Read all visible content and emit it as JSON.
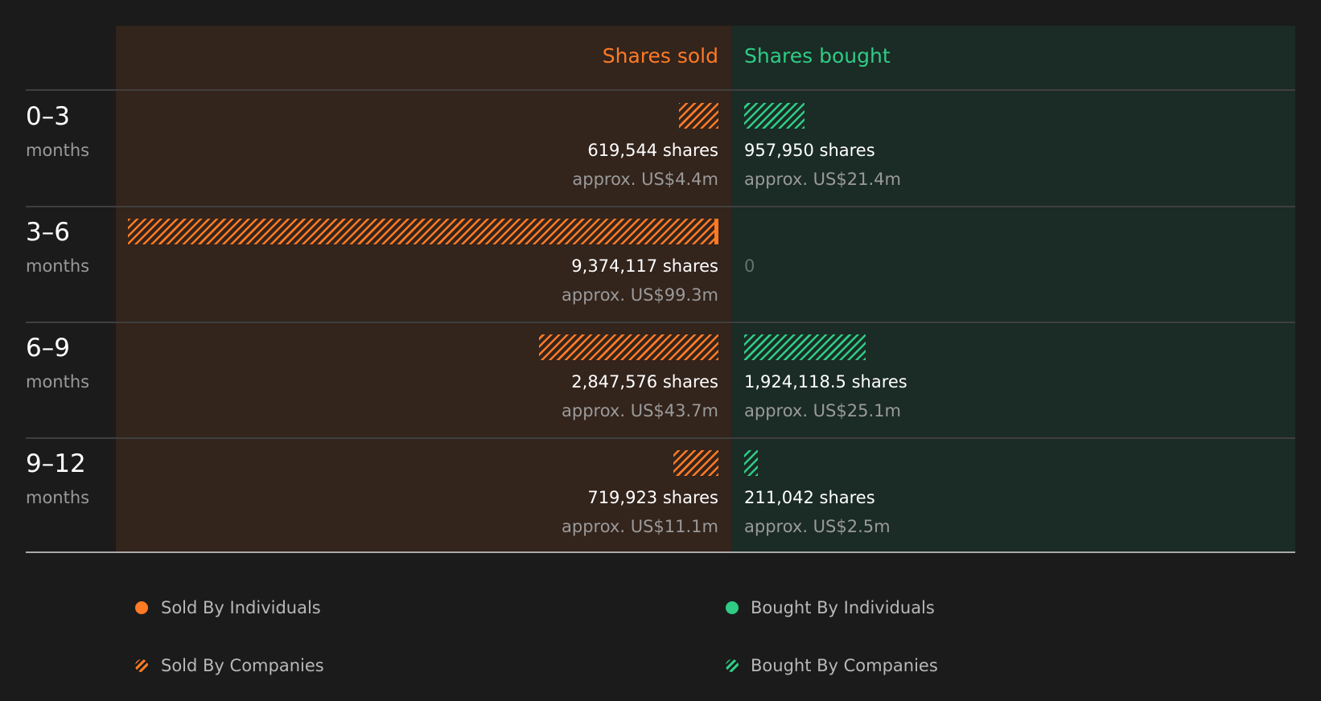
{
  "chart_data": {
    "type": "bar",
    "columns": {
      "sold_label": "Shares sold",
      "bought_label": "Shares bought"
    },
    "rows": [
      {
        "period": "0–3",
        "unit": "months",
        "sold_value": 619544,
        "sold_shares": "619,544 shares",
        "sold_approx": "approx. US$4.4m",
        "bought_value": 957950,
        "bought_shares": "957,950 shares",
        "bought_approx": "approx. US$21.4m"
      },
      {
        "period": "3–6",
        "unit": "months",
        "sold_value": 9374117,
        "sold_shares": "9,374,117 shares",
        "sold_approx": "approx. US$99.3m",
        "sold_individuals_value": 140000,
        "bought_value": 0,
        "bought_shares": "0",
        "bought_approx": ""
      },
      {
        "period": "6–9",
        "unit": "months",
        "sold_value": 2847576,
        "sold_shares": "2,847,576 shares",
        "sold_approx": "approx. US$43.7m",
        "bought_value": 1924118.5,
        "bought_shares": "1,924,118.5 shares",
        "bought_approx": "approx. US$25.1m"
      },
      {
        "period": "9–12",
        "unit": "months",
        "sold_value": 719923,
        "sold_shares": "719,923 shares",
        "sold_approx": "approx. US$11.1m",
        "bought_value": 211042,
        "bought_shares": "211,042 shares",
        "bought_approx": "approx. US$2.5m"
      }
    ],
    "max_value": 9374117,
    "legend": [
      {
        "label": "Sold By Individuals",
        "style": "solid",
        "color": "#ff7a25"
      },
      {
        "label": "Bought By Individuals",
        "style": "solid",
        "color": "#2ecc85"
      },
      {
        "label": "Sold By Companies",
        "style": "hatched",
        "color": "#ff7a25"
      },
      {
        "label": "Bought By Companies",
        "style": "hatched",
        "color": "#2ecc85"
      }
    ],
    "colors": {
      "sold": "#ff7a25",
      "bought": "#2ecc85",
      "sold_background": "#33241c",
      "bought_background": "#1b2b25",
      "page_background": "#1b1b1b"
    }
  }
}
